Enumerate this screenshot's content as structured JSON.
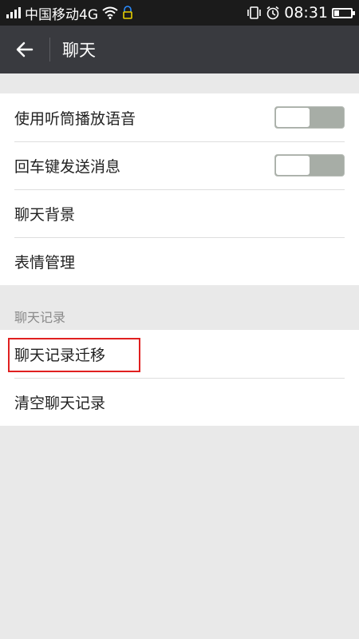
{
  "status_bar": {
    "carrier": "中国移动4G",
    "time": "08:31",
    "icons": [
      "signal-icon",
      "wifi-icon",
      "lock-icon",
      "vibrate-icon",
      "alarm-icon",
      "battery-icon"
    ]
  },
  "header": {
    "title": "聊天",
    "back_icon": "back-arrow-icon"
  },
  "settings": {
    "items": [
      {
        "label": "使用听筒播放语音",
        "toggle": false
      },
      {
        "label": "回车键发送消息",
        "toggle": false
      },
      {
        "label": "聊天背景"
      },
      {
        "label": "表情管理"
      }
    ]
  },
  "chat_history": {
    "header": "聊天记录",
    "items": [
      {
        "label": "聊天记录迁移"
      },
      {
        "label": "清空聊天记录"
      }
    ]
  },
  "colors": {
    "title_bar": "#393a3f",
    "status_bar": "#1b1b1b",
    "background": "#e9e9e9",
    "highlight": "#e02020"
  }
}
